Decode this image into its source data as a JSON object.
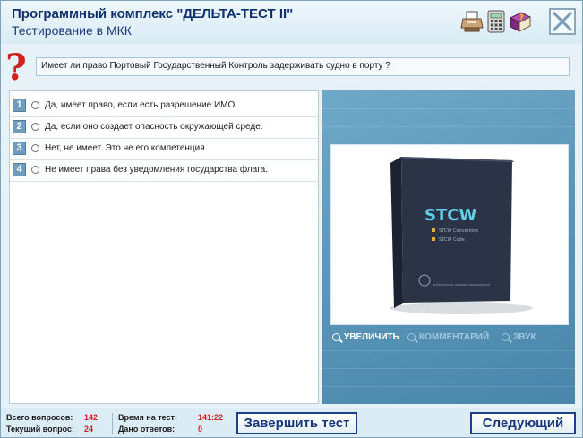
{
  "header": {
    "title": "Программный комплекс \"ДЕЛЬТА-ТЕСТ II\"",
    "subtitle": "Тестирование в МКК",
    "icons": [
      "printer-icon",
      "calculator-icon",
      "help-book-icon",
      "close-icon"
    ]
  },
  "question": {
    "icon": "question-mark-icon",
    "text": "Имеет ли право Портовый Государственный Контроль задерживать судно в порту ?"
  },
  "answers": [
    {
      "num": "1",
      "text": "Да, имеет право, если есть разрешение ИМО"
    },
    {
      "num": "2",
      "text": "Да, если оно создает опасность окружающей среде."
    },
    {
      "num": "3",
      "text": "Нет, не имеет. Это не его компетенция"
    },
    {
      "num": "4",
      "text": "Не имеет права без уведомления государства флага."
    }
  ],
  "media": {
    "book_title": "STCW",
    "book_lines": [
      "STCW Convention",
      "STCW Code"
    ],
    "book_footer": "INTERNATIONAL MARITIME ORGANIZATION",
    "buttons": [
      {
        "label": "УВЕЛИЧИТЬ",
        "enabled": true
      },
      {
        "label": "КОММЕНТАРИЙ",
        "enabled": false
      },
      {
        "label": "ЗВУК",
        "enabled": false
      }
    ]
  },
  "footer": {
    "total_questions_label": "Всего вопросов:",
    "total_questions": "142",
    "current_question_label": "Текущий вопрос:",
    "current_question": "24",
    "test_time_label": "Время на тест:",
    "test_time": "141:22",
    "answers_given_label": "Дано ответов:",
    "answers_given": "0",
    "finish_button": "Завершить тест",
    "next_button": "Следующий"
  },
  "colors": {
    "accent": "#1d3f86",
    "value": "#d02020",
    "panel": "#5b97b9"
  }
}
